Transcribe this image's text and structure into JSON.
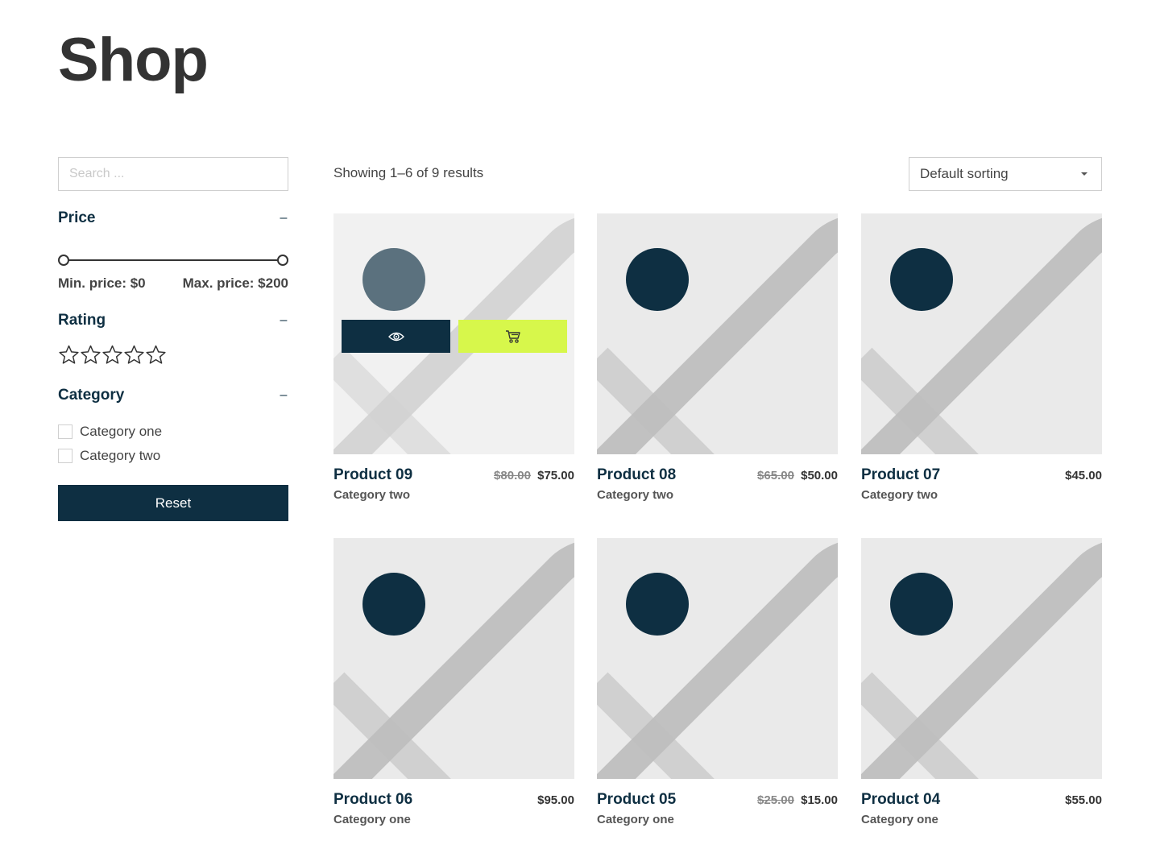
{
  "page": {
    "title": "Shop"
  },
  "sidebar": {
    "search": {
      "placeholder": "Search ...",
      "value": "",
      "icon": "none"
    },
    "price": {
      "title": "Price",
      "toggle": "–",
      "min_label": "Min. price: $0",
      "max_label": "Max. price: $200",
      "range_min": 0,
      "range_max": 200,
      "selected_min": 0,
      "selected_max": 200
    },
    "rating": {
      "title": "Rating",
      "toggle": "–",
      "stars_total": 5,
      "stars_selected": 0,
      "icon": "star-outline-icon"
    },
    "category": {
      "title": "Category",
      "toggle": "–",
      "items": [
        {
          "label": "Category one",
          "checked": false
        },
        {
          "label": "Category two",
          "checked": false
        }
      ]
    },
    "reset_label": "Reset"
  },
  "toolbar": {
    "result_count": "Showing 1–6 of 9 results",
    "sort_label": "Default sorting"
  },
  "colors": {
    "navy": "#0e2f42",
    "lime": "#d7f74b",
    "placeholder_bg": "#eaeaea",
    "text": "#333333"
  },
  "products": [
    {
      "name": "Product 09",
      "category": "Category two",
      "old_price": "$80.00",
      "price": "$75.00",
      "hovered": true,
      "actions": {
        "view_icon": "eye-icon",
        "cart_icon": "cart-icon"
      }
    },
    {
      "name": "Product 08",
      "category": "Category two",
      "old_price": "$65.00",
      "price": "$50.00",
      "hovered": false
    },
    {
      "name": "Product 07",
      "category": "Category two",
      "old_price": "",
      "price": "$45.00",
      "hovered": false
    },
    {
      "name": "Product 06",
      "category": "Category one",
      "old_price": "",
      "price": "$95.00",
      "hovered": false
    },
    {
      "name": "Product 05",
      "category": "Category one",
      "old_price": "$25.00",
      "price": "$15.00",
      "hovered": false
    },
    {
      "name": "Product 04",
      "category": "Category one",
      "old_price": "",
      "price": "$55.00",
      "hovered": false
    }
  ]
}
